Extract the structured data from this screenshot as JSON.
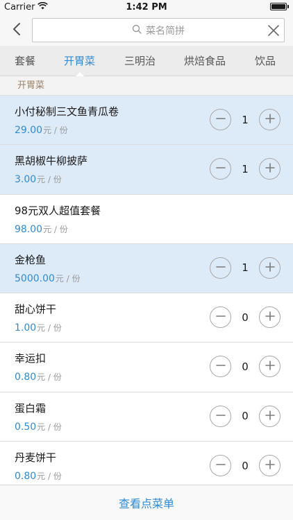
{
  "status_bar": {
    "carrier": "Carrier",
    "time": "1:42 PM"
  },
  "nav": {
    "search_placeholder": "菜名简拼"
  },
  "tabs": [
    {
      "label": "套餐",
      "active": false
    },
    {
      "label": "开胃菜",
      "active": true
    },
    {
      "label": "三明治",
      "active": false
    },
    {
      "label": "烘焙食品",
      "active": false
    },
    {
      "label": "饮品",
      "active": false
    }
  ],
  "section": {
    "title": "开胃菜"
  },
  "items": [
    {
      "name": "小付秘制三文鱼青瓜卷",
      "price": "29.00",
      "unit": "元 / 份",
      "qty": "1",
      "selected": true,
      "show_stepper": true
    },
    {
      "name": "黑胡椒牛柳披萨",
      "price": "3.00",
      "unit": "元 / 份",
      "qty": "1",
      "selected": true,
      "show_stepper": true
    },
    {
      "name": "98元双人超值套餐",
      "price": "98.00",
      "unit": "元 / 份",
      "qty": "",
      "selected": false,
      "show_stepper": false
    },
    {
      "name": "金枪鱼",
      "price": "5000.00",
      "unit": "元 / 份",
      "qty": "1",
      "selected": true,
      "show_stepper": true
    },
    {
      "name": "甜心饼干",
      "price": "1.00",
      "unit": "元 / 份",
      "qty": "0",
      "selected": false,
      "show_stepper": true
    },
    {
      "name": "幸运扣",
      "price": "0.80",
      "unit": "元 / 份",
      "qty": "0",
      "selected": false,
      "show_stepper": true
    },
    {
      "name": "蛋白霜",
      "price": "0.50",
      "unit": "元 / 份",
      "qty": "0",
      "selected": false,
      "show_stepper": true
    },
    {
      "name": "丹麦饼干",
      "price": "0.80",
      "unit": "元 / 份",
      "qty": "0",
      "selected": false,
      "show_stepper": true
    }
  ],
  "footer": {
    "label": "查看点菜单"
  },
  "colors": {
    "accent": "#2e8bd6",
    "selected_bg": "#ddeaf8",
    "section_text": "#9b7f62"
  },
  "icons": {
    "back": "chevron-left-icon",
    "search": "search-icon",
    "clear": "close-icon",
    "minus": "minus-icon",
    "plus": "plus-icon"
  }
}
